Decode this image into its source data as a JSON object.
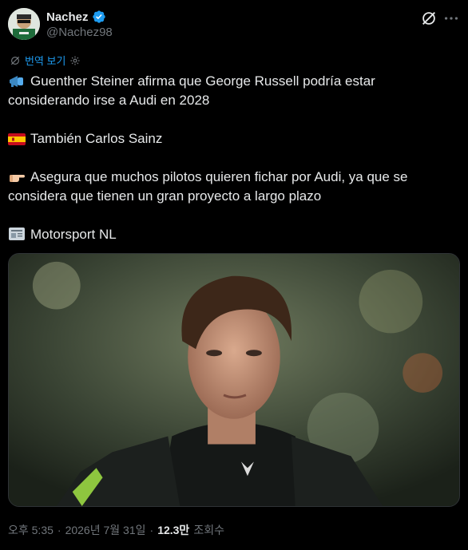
{
  "author": {
    "display_name": "Nachez",
    "handle": "@Nachez98",
    "verified": true
  },
  "header_icons": {
    "grok": "grok-icon",
    "more": "more-icon"
  },
  "translate": {
    "label": "번역 보기"
  },
  "tweet": {
    "paragraphs": [
      {
        "emoji": "megaphone",
        "text": "Guenther Steiner afirma que George Russell podría estar considerando irse a Audi en 2028"
      },
      {
        "emoji": "flag-es",
        "text": "También Carlos Sainz"
      },
      {
        "emoji": "point-right",
        "text": "Asegura que muchos pilotos quieren fichar por Audi, ya que se considera que tienen un gran proyecto a largo plazo"
      },
      {
        "emoji": "newspaper",
        "text": "Motorsport NL"
      }
    ]
  },
  "meta": {
    "time": "오후 5:35",
    "separator": "·",
    "date": "2026년 7월 31일",
    "views": "12.3만",
    "views_label": "조회수"
  },
  "colors": {
    "accent": "#1d9bf0",
    "text": "#e7e9ea",
    "muted": "#71767b",
    "background": "#000000"
  }
}
